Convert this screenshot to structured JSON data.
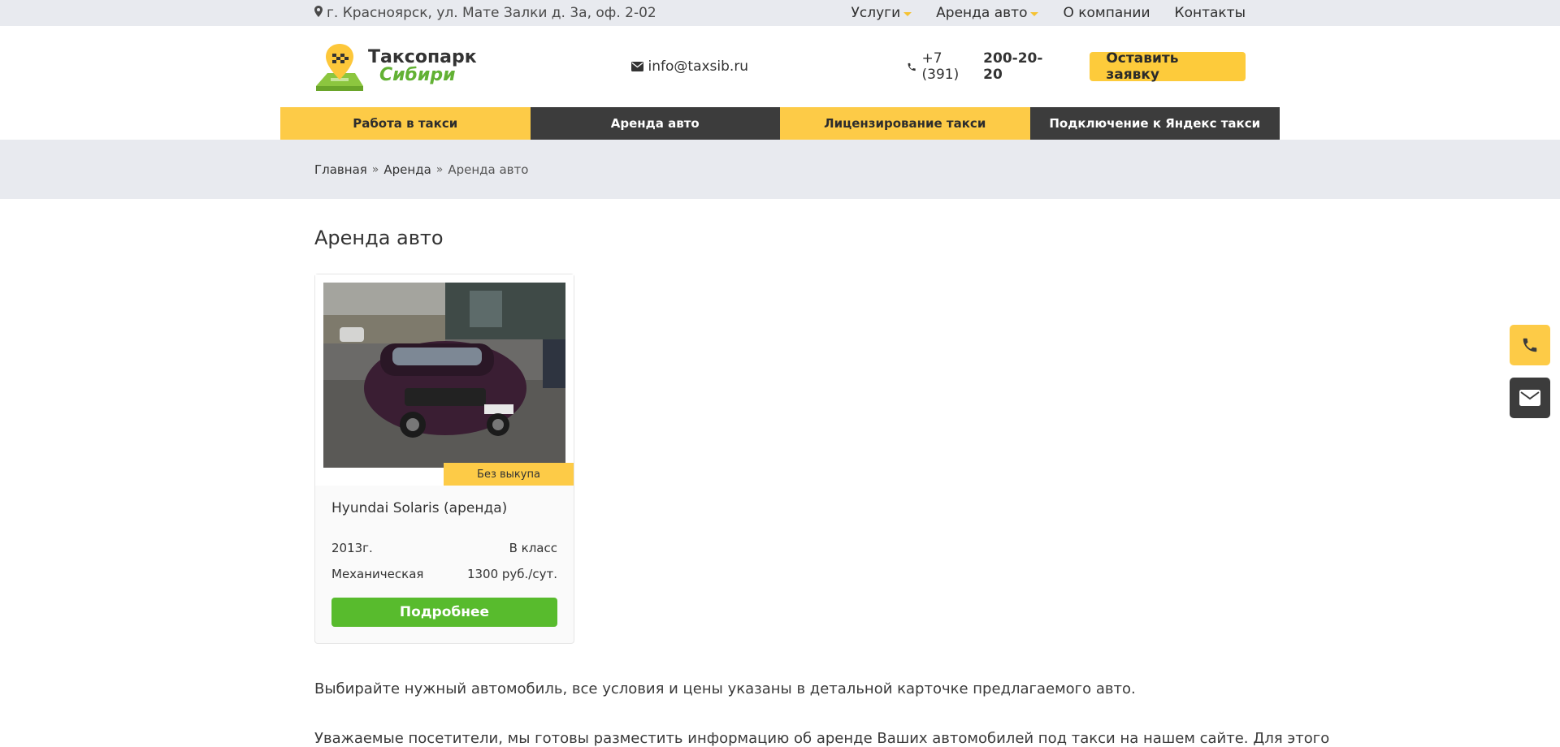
{
  "topbar": {
    "address": "г. Красноярск, ул. Мате Залки д. 3а, оф. 2-02",
    "nav": [
      {
        "label": "Услуги",
        "dropdown": true
      },
      {
        "label": "Аренда авто",
        "dropdown": true
      },
      {
        "label": "О компании",
        "dropdown": false
      },
      {
        "label": "Контакты",
        "dropdown": false
      }
    ]
  },
  "header": {
    "logo_line1": "Таксопарк",
    "logo_line2": "Сибири",
    "email": "info@taxsib.ru",
    "phone_prefix": "+7 (391)",
    "phone_number": "200-20-20",
    "cta_label": "Оставить заявку"
  },
  "mainnav": {
    "items": [
      {
        "label": "Работа в такси"
      },
      {
        "label": "Аренда авто"
      },
      {
        "label": "Лицензирование такси"
      },
      {
        "label": "Подключение к Яндекс такси"
      }
    ]
  },
  "breadcrumb": {
    "home": "Главная",
    "parent": "Аренда",
    "current": "Аренда авто"
  },
  "main": {
    "title": "Аренда авто",
    "card": {
      "badge": "Без выкупа",
      "title": "Hyundai Solaris (аренда)",
      "year": "2013г.",
      "class": "В класс",
      "transmission": "Механическая",
      "price": "1300 руб./сут.",
      "more_label": "Подробнее"
    },
    "paragraph1": "Выбирайте нужный автомобиль, все условия и цены указаны в детальной карточке предлагаемого авто.",
    "paragraph2": "Уважаемые посетители, мы готовы разместить информацию об аренде Ваших автомобилей под такси на нашем сайте. Для этого"
  },
  "colors": {
    "accent_yellow": "#fdcb47",
    "accent_green": "#58bb2d",
    "dark": "#3c3c3c",
    "band_gray": "#e8eaef"
  },
  "icons": {
    "address": "map-pin-icon",
    "dropdown": "caret-down-icon",
    "email": "envelope-icon",
    "phone": "phone-icon",
    "breadcrumb_sep": "double-chevron-right-icon",
    "float_phone": "phone-icon",
    "float_mail": "envelope-icon"
  }
}
